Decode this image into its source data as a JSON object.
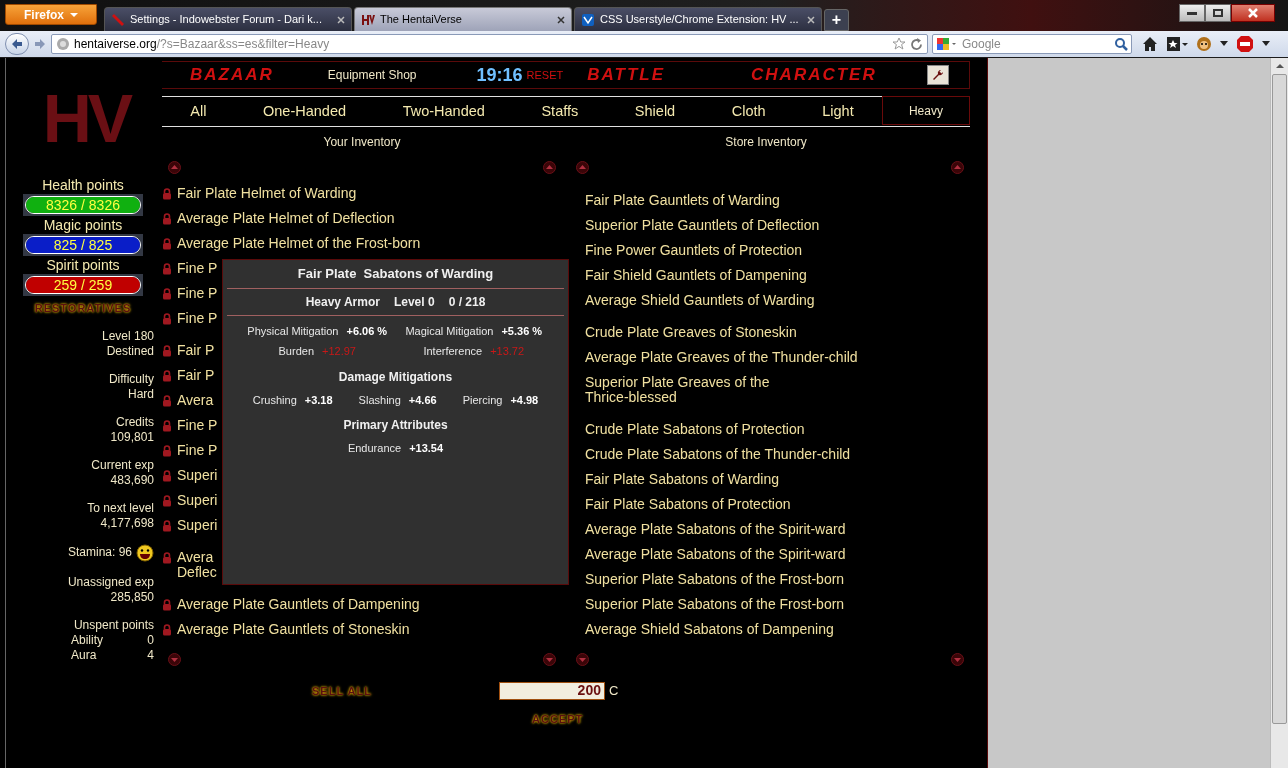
{
  "browser": {
    "menu_button": "Firefox",
    "tabs": [
      {
        "title": "Settings - Indowebster Forum - Dari k...",
        "selected": false
      },
      {
        "title": "The HentaiVerse",
        "selected": true
      },
      {
        "title": "CSS Userstyle/Chrome Extension: HV ...",
        "selected": false
      }
    ],
    "new_tab": "+",
    "url_host": "hentaiverse.org",
    "url_path": "/?s=Bazaar&ss=es&filter=Heavy",
    "search_placeholder": "Google"
  },
  "sidebar": {
    "logo": "HV",
    "bars": [
      {
        "label": "Health points",
        "reading": "8326 / 8326",
        "level": 1,
        "color": "#10b010"
      },
      {
        "label": "Magic points",
        "reading": "825 / 825",
        "level": 1,
        "color": "#0a1ec8"
      },
      {
        "label": "Spirit points",
        "reading": "259 / 259",
        "level": 1,
        "color": "#c00000"
      }
    ],
    "restoratives": "RESTORATIVES",
    "stats": [
      {
        "kind": "pair",
        "label": "Level 180",
        "value": "Destined"
      },
      {
        "kind": "pair",
        "label": "Difficulty",
        "value": "Hard"
      },
      {
        "kind": "pair",
        "label": "Credits",
        "value": "109,801"
      },
      {
        "kind": "pair",
        "label": "Current exp",
        "value": "483,690"
      },
      {
        "kind": "pair",
        "label": "To next level",
        "value": "4,177,698"
      },
      {
        "kind": "stamina",
        "label": "Stamina: 96"
      },
      {
        "kind": "pair",
        "label": "Unassigned exp",
        "value": "285,850"
      },
      {
        "kind": "points",
        "label": "Unspent points",
        "rows": [
          {
            "label": "Ability",
            "value": "0"
          },
          {
            "label": "Aura",
            "value": "4"
          }
        ]
      }
    ]
  },
  "header": {
    "bazaar": "BAZAAR",
    "shop": "Equipment Shop",
    "time": "19:16",
    "reset": "RESET",
    "battle": "BATTLE",
    "character": "CHARACTER"
  },
  "filters": [
    {
      "label": "All",
      "selected": false
    },
    {
      "label": "One-Handed",
      "selected": false
    },
    {
      "label": "Two-Handed",
      "selected": false
    },
    {
      "label": "Staffs",
      "selected": false
    },
    {
      "label": "Shield",
      "selected": false
    },
    {
      "label": "Cloth",
      "selected": false
    },
    {
      "label": "Light",
      "selected": false
    },
    {
      "label": "Heavy",
      "selected": true
    }
  ],
  "your_inventory": {
    "heading": "Your Inventory",
    "locked": true,
    "groups": [
      [
        {
          "lines": [
            "Fair Plate Helmet of Warding"
          ]
        },
        {
          "lines": [
            "Average Plate Helmet of Deflection"
          ]
        },
        {
          "lines": [
            "Average Plate Helmet of the Frost-born"
          ]
        },
        {
          "lines": [
            "Fine P"
          ]
        },
        {
          "lines": [
            "Fine P"
          ]
        },
        {
          "lines": [
            "Fine P"
          ]
        }
      ],
      [
        {
          "lines": [
            "Fair P"
          ]
        },
        {
          "lines": [
            "Fair P"
          ]
        },
        {
          "lines": [
            "Avera"
          ]
        },
        {
          "lines": [
            "Fine P"
          ]
        },
        {
          "lines": [
            "Fine P"
          ]
        },
        {
          "lines": [
            "Superi"
          ]
        },
        {
          "lines": [
            "Superi"
          ]
        },
        {
          "lines": [
            "Superi"
          ]
        }
      ],
      [
        {
          "lines": [
            "Avera",
            "Deflec"
          ]
        }
      ],
      [
        {
          "lines": [
            "Average Plate Gauntlets of Dampening"
          ]
        },
        {
          "lines": [
            "Average Plate Gauntlets of Stoneskin"
          ]
        }
      ]
    ]
  },
  "store_inventory": {
    "heading": "Store Inventory",
    "locked": false,
    "groups": [
      [
        {
          "lines": [
            "Fair Plate Gauntlets of Warding"
          ]
        },
        {
          "lines": [
            "Superior Plate Gauntlets of Deflection"
          ]
        },
        {
          "lines": [
            "Fine Power Gauntlets of Protection"
          ]
        },
        {
          "lines": [
            "Fair Shield Gauntlets of Dampening"
          ]
        },
        {
          "lines": [
            "Average Shield Gauntlets of Warding"
          ]
        }
      ],
      [
        {
          "lines": [
            "Crude Plate Greaves of Stoneskin"
          ]
        },
        {
          "lines": [
            "Average Plate Greaves of the Thunder-child"
          ]
        },
        {
          "lines": [
            "Superior Plate Greaves of the",
            "Thrice-blessed"
          ]
        }
      ],
      [
        {
          "lines": [
            "Crude Plate Sabatons of Protection"
          ]
        },
        {
          "lines": [
            "Crude Plate Sabatons of the Thunder-child"
          ]
        },
        {
          "lines": [
            "Fair Plate Sabatons of Warding"
          ]
        },
        {
          "lines": [
            "Fair Plate Sabatons of Protection"
          ]
        },
        {
          "lines": [
            "Average Plate Sabatons of the Spirit-ward"
          ]
        },
        {
          "lines": [
            "Average Plate Sabatons of the Spirit-ward"
          ]
        },
        {
          "lines": [
            "Superior Plate Sabatons of the Frost-born"
          ]
        },
        {
          "lines": [
            "Superior Plate Sabatons of the Frost-born"
          ]
        },
        {
          "lines": [
            "Average Shield Sabatons of Dampening"
          ]
        }
      ]
    ]
  },
  "tooltip": {
    "title": "Fair Plate  Sabatons of Warding",
    "meta": [
      "Heavy Armor",
      "Level 0",
      "0 / 218"
    ],
    "stats": [
      {
        "label": "Physical Mitigation",
        "value": "+6.06 %",
        "penalty": false
      },
      {
        "label": "Magical Mitigation",
        "value": "+5.36 %",
        "penalty": false
      },
      {
        "label": "Burden",
        "value": "+12.97",
        "penalty": true
      },
      {
        "label": "Interference",
        "value": "+13.72",
        "penalty": true
      }
    ],
    "sections": [
      {
        "heading": "Damage Mitigations",
        "stats": [
          {
            "label": "Crushing",
            "value": "+3.18",
            "penalty": false
          },
          {
            "label": "Slashing",
            "value": "+4.66",
            "penalty": false
          },
          {
            "label": "Piercing",
            "value": "+4.98",
            "penalty": false
          }
        ]
      },
      {
        "heading": "Primary Attributes",
        "stats": [
          {
            "label": "Endurance",
            "value": "+13.54",
            "penalty": false
          }
        ]
      }
    ]
  },
  "footer": {
    "sell_all": "SELL ALL",
    "price": "200",
    "currency": "C",
    "accept": "ACCEPT"
  }
}
